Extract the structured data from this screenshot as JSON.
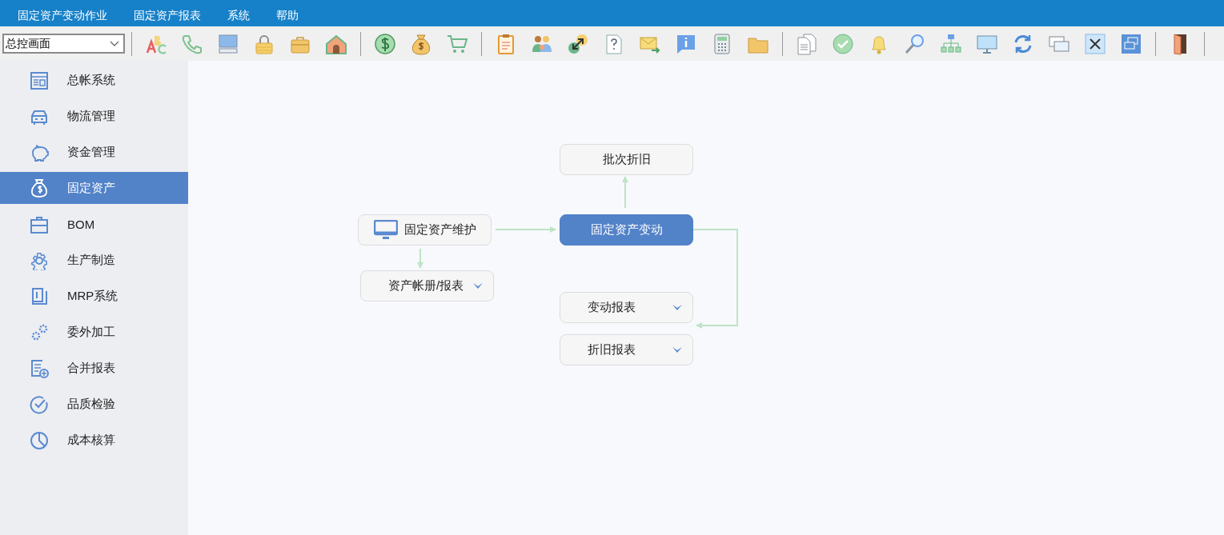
{
  "menu_bar": [
    {
      "label": "固定资产变动作业"
    },
    {
      "label": "固定资产报表"
    },
    {
      "label": "系统"
    },
    {
      "label": "帮助"
    }
  ],
  "toolbar": {
    "screen_select": {
      "value": "总控画面"
    }
  },
  "sidebar": {
    "items": [
      {
        "label": "总帐系统",
        "selected": false
      },
      {
        "label": "物流管理",
        "selected": false
      },
      {
        "label": "资金管理",
        "selected": false
      },
      {
        "label": "固定资产",
        "selected": true
      },
      {
        "label": "BOM",
        "selected": false
      },
      {
        "label": "生产制造",
        "selected": false
      },
      {
        "label": "MRP系统",
        "selected": false
      },
      {
        "label": "委外加工",
        "selected": false
      },
      {
        "label": "合并报表",
        "selected": false
      },
      {
        "label": "品质检验",
        "selected": false
      },
      {
        "label": "成本核算",
        "selected": false
      }
    ]
  },
  "flow": {
    "nodes": [
      {
        "label": "批次折旧",
        "kind": "plain",
        "selected": false
      },
      {
        "label": "固定资产维护",
        "kind": "icon",
        "selected": false
      },
      {
        "label": "固定资产变动",
        "kind": "plain",
        "selected": true
      },
      {
        "label": "资产帐册/报表",
        "kind": "dropdown",
        "selected": false
      },
      {
        "label": "变动报表",
        "kind": "dropdown",
        "selected": false
      },
      {
        "label": "折旧报表",
        "kind": "dropdown",
        "selected": false
      }
    ]
  }
}
